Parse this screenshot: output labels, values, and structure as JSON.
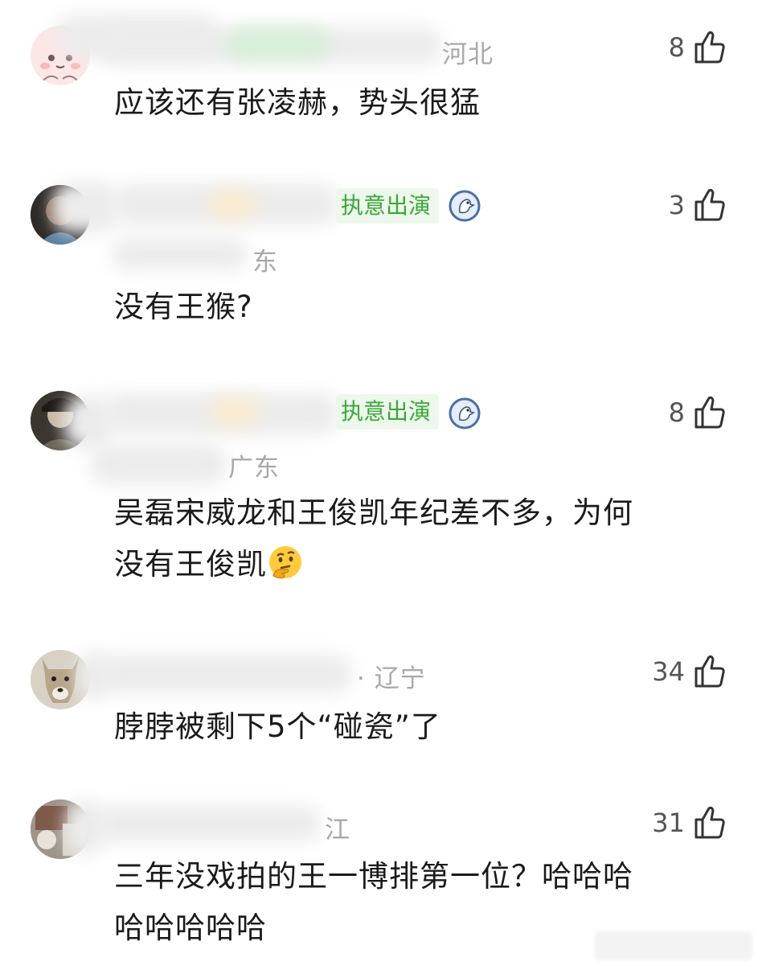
{
  "comments": [
    {
      "location": "河北",
      "likes": "8",
      "text": "应该还有张凌赫，势头很猛",
      "text2": ""
    },
    {
      "badge": "执意出演",
      "location": "东",
      "likes": "3",
      "text": "没有王猴?",
      "text2": ""
    },
    {
      "badge": "执意出演",
      "location": "广东",
      "likes": "8",
      "text": "吴磊宋威龙和王俊凯年纪差不多，为何",
      "text2": "没有王俊凯",
      "emoji": "thinking-face"
    },
    {
      "location": "· 辽宁",
      "likes": "34",
      "text": "脖脖被剩下5个“碰瓷”了",
      "text2": ""
    },
    {
      "location": "江",
      "likes": "31",
      "text": "三年没戏拍的王一博排第一位？哈哈哈",
      "text2": "哈哈哈哈哈"
    }
  ],
  "colors": {
    "badge_text": "#3aa83a",
    "location": "#a8a8a8",
    "text": "#1a1a1a"
  }
}
